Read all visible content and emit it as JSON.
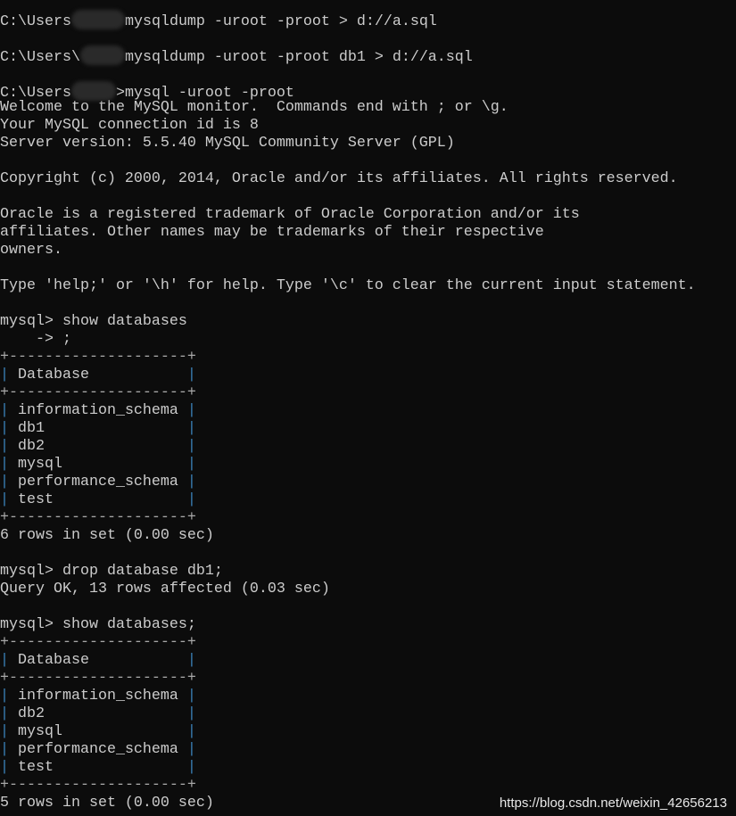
{
  "terminal": {
    "background": "#0c0c0c",
    "foreground": "#cccccc",
    "border_color": "#3a7fb5",
    "lines": [
      {
        "kind": "redacted",
        "prefix": "C:\\Users",
        "blob": 60,
        "suffix": "mysqldump -uroot -proot > d://a.sql"
      },
      "",
      {
        "kind": "redacted",
        "prefix": "C:\\Users\\",
        "blob": 50,
        "suffix": "mysqldump -uroot -proot db1 > d://a.sql"
      },
      "",
      {
        "kind": "redacted",
        "prefix": "C:\\Users",
        "blob": 50,
        "suffix": ">mysql -uroot -proot"
      },
      "Welcome to the MySQL monitor.  Commands end with ; or \\g.",
      "Your MySQL connection id is 8",
      "Server version: 5.5.40 MySQL Community Server (GPL)",
      "",
      "Copyright (c) 2000, 2014, Oracle and/or its affiliates. All rights reserved.",
      "",
      "Oracle is a registered trademark of Oracle Corporation and/or its",
      "affiliates. Other names may be trademarks of their respective",
      "owners.",
      "",
      "Type 'help;' or '\\h' for help. Type '\\c' to clear the current input statement.",
      "",
      "mysql> show databases",
      "    -> ;",
      {
        "kind": "border"
      },
      {
        "kind": "row",
        "cell": "Database"
      },
      {
        "kind": "border"
      },
      {
        "kind": "row",
        "cell": "information_schema"
      },
      {
        "kind": "row",
        "cell": "db1"
      },
      {
        "kind": "row",
        "cell": "db2"
      },
      {
        "kind": "row",
        "cell": "mysql"
      },
      {
        "kind": "row",
        "cell": "performance_schema"
      },
      {
        "kind": "row",
        "cell": "test"
      },
      {
        "kind": "border"
      },
      "6 rows in set (0.00 sec)",
      "",
      "mysql> drop database db1;",
      "Query OK, 13 rows affected (0.03 sec)",
      "",
      "mysql> show databases;",
      {
        "kind": "border"
      },
      {
        "kind": "row",
        "cell": "Database"
      },
      {
        "kind": "border"
      },
      {
        "kind": "row",
        "cell": "information_schema"
      },
      {
        "kind": "row",
        "cell": "db2"
      },
      {
        "kind": "row",
        "cell": "mysql"
      },
      {
        "kind": "row",
        "cell": "performance_schema"
      },
      {
        "kind": "row",
        "cell": "test"
      },
      {
        "kind": "border"
      },
      "5 rows in set (0.00 sec)"
    ]
  },
  "watermark": "https://blog.csdn.net/weixin_42656213"
}
